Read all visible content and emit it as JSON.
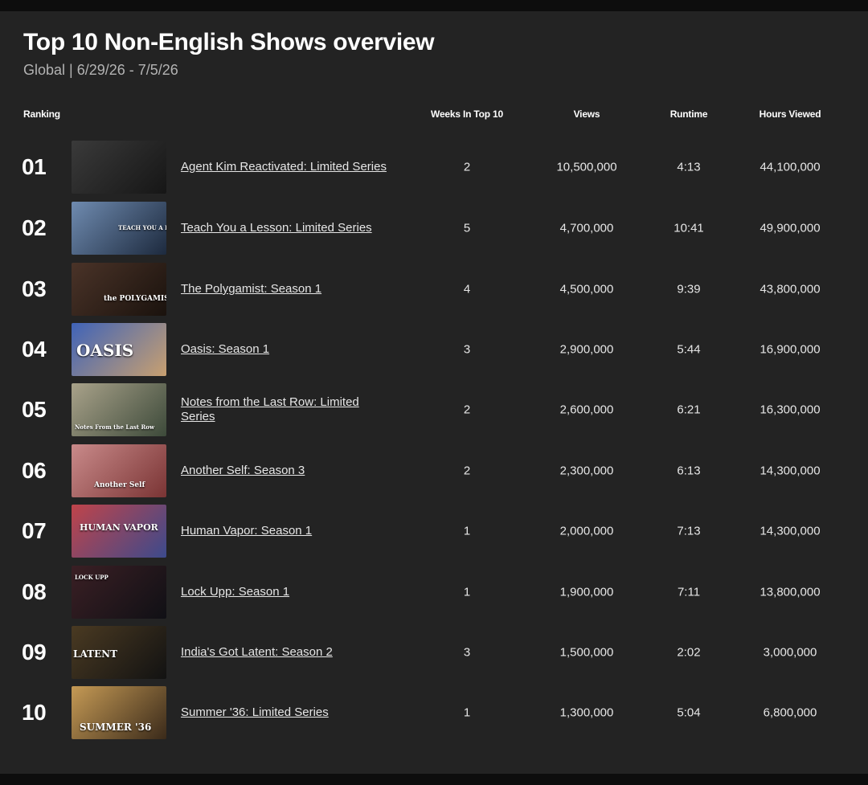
{
  "header": {
    "title": "Top 10 Non-English Shows overview",
    "subtitle": "Global | 6/29/26 - 7/5/26"
  },
  "columns": {
    "ranking": "Ranking",
    "weeks": "Weeks In Top 10",
    "views": "Views",
    "runtime": "Runtime",
    "hours": "Hours Viewed"
  },
  "rows": [
    {
      "rank": "01",
      "title": "Agent Kim Reactivated: Limited Series",
      "weeks": "2",
      "views": "10,500,000",
      "runtime": "4:13",
      "hours": "44,100,000"
    },
    {
      "rank": "02",
      "title": "Teach You a Lesson: Limited Series",
      "weeks": "5",
      "views": "4,700,000",
      "runtime": "10:41",
      "hours": "49,900,000"
    },
    {
      "rank": "03",
      "title": "The Polygamist: Season 1",
      "weeks": "4",
      "views": "4,500,000",
      "runtime": "9:39",
      "hours": "43,800,000"
    },
    {
      "rank": "04",
      "title": "Oasis: Season 1",
      "weeks": "3",
      "views": "2,900,000",
      "runtime": "5:44",
      "hours": "16,900,000"
    },
    {
      "rank": "05",
      "title": "Notes from the Last Row: Limited Series",
      "weeks": "2",
      "views": "2,600,000",
      "runtime": "6:21",
      "hours": "16,300,000"
    },
    {
      "rank": "06",
      "title": "Another Self: Season 3",
      "weeks": "2",
      "views": "2,300,000",
      "runtime": "6:13",
      "hours": "14,300,000"
    },
    {
      "rank": "07",
      "title": "Human Vapor: Season 1",
      "weeks": "1",
      "views": "2,000,000",
      "runtime": "7:13",
      "hours": "14,300,000"
    },
    {
      "rank": "08",
      "title": "Lock Upp: Season 1",
      "weeks": "1",
      "views": "1,900,000",
      "runtime": "7:11",
      "hours": "13,800,000"
    },
    {
      "rank": "09",
      "title": "India's Got Latent: Season 2",
      "weeks": "3",
      "views": "1,500,000",
      "runtime": "2:02",
      "hours": "3,000,000"
    },
    {
      "rank": "10",
      "title": "Summer '36: Limited Series",
      "weeks": "1",
      "views": "1,300,000",
      "runtime": "5:04",
      "hours": "6,800,000"
    }
  ],
  "thumbnails": [
    {
      "text": "",
      "colors": [
        "#3a3a3a",
        "#161616"
      ]
    },
    {
      "text": "TEACH YOU A LESSON",
      "colors": [
        "#6f8bb0",
        "#1d2a3e"
      ]
    },
    {
      "text": "the POLYGAMIST",
      "colors": [
        "#4a3328",
        "#1a120d"
      ]
    },
    {
      "text": "OASIS",
      "colors": [
        "#3f63b8",
        "#c8a070"
      ]
    },
    {
      "text": "Notes From the Last Row",
      "colors": [
        "#a9a28a",
        "#3d4a3a"
      ]
    },
    {
      "text": "Another Self",
      "colors": [
        "#c98a8a",
        "#7a3434"
      ]
    },
    {
      "text": "HUMAN VAPOR",
      "colors": [
        "#c0444a",
        "#3c4a8c"
      ]
    },
    {
      "text": "LOCK UPP",
      "colors": [
        "#3a1f24",
        "#101015"
      ]
    },
    {
      "text": "LATENT",
      "colors": [
        "#4a3a22",
        "#121212"
      ]
    },
    {
      "text": "SUMMER '36",
      "colors": [
        "#c59a55",
        "#3a2a1a"
      ]
    }
  ]
}
